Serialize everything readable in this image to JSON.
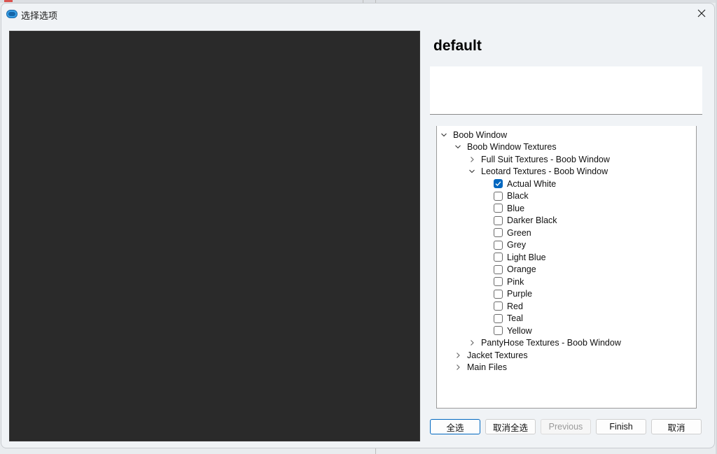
{
  "window": {
    "title": "选择选项"
  },
  "heading": "default",
  "description": "",
  "tree": [
    {
      "label": "Boob Window",
      "kind": "folder",
      "expanded": true
    },
    {
      "label": "Boob Window Textures",
      "kind": "folder",
      "expanded": true
    },
    {
      "label": "Full Suit Textures - Boob Window",
      "kind": "folder",
      "expanded": false
    },
    {
      "label": "Leotard Textures - Boob Window",
      "kind": "folder",
      "expanded": true
    },
    {
      "label": "Actual White",
      "kind": "option",
      "checked": true
    },
    {
      "label": "Black",
      "kind": "option",
      "checked": false
    },
    {
      "label": "Blue",
      "kind": "option",
      "checked": false
    },
    {
      "label": "Darker Black",
      "kind": "option",
      "checked": false
    },
    {
      "label": "Green",
      "kind": "option",
      "checked": false
    },
    {
      "label": "Grey",
      "kind": "option",
      "checked": false
    },
    {
      "label": "Light Blue",
      "kind": "option",
      "checked": false
    },
    {
      "label": "Orange",
      "kind": "option",
      "checked": false
    },
    {
      "label": "Pink",
      "kind": "option",
      "checked": false
    },
    {
      "label": "Purple",
      "kind": "option",
      "checked": false
    },
    {
      "label": "Red",
      "kind": "option",
      "checked": false
    },
    {
      "label": "Teal",
      "kind": "option",
      "checked": false
    },
    {
      "label": "Yellow",
      "kind": "option",
      "checked": false
    },
    {
      "label": "PantyHose Textures - Boob Window",
      "kind": "folder",
      "expanded": false
    },
    {
      "label": "Jacket Textures",
      "kind": "folder",
      "expanded": false
    },
    {
      "label": "Main Files",
      "kind": "folder",
      "expanded": false
    }
  ],
  "buttons": {
    "select_all": "全选",
    "deselect_all": "取消全选",
    "previous": "Previous",
    "finish": "Finish",
    "cancel": "取消"
  },
  "colors": {
    "accent": "#0067c0",
    "preview_bg": "#2a2a2a"
  }
}
